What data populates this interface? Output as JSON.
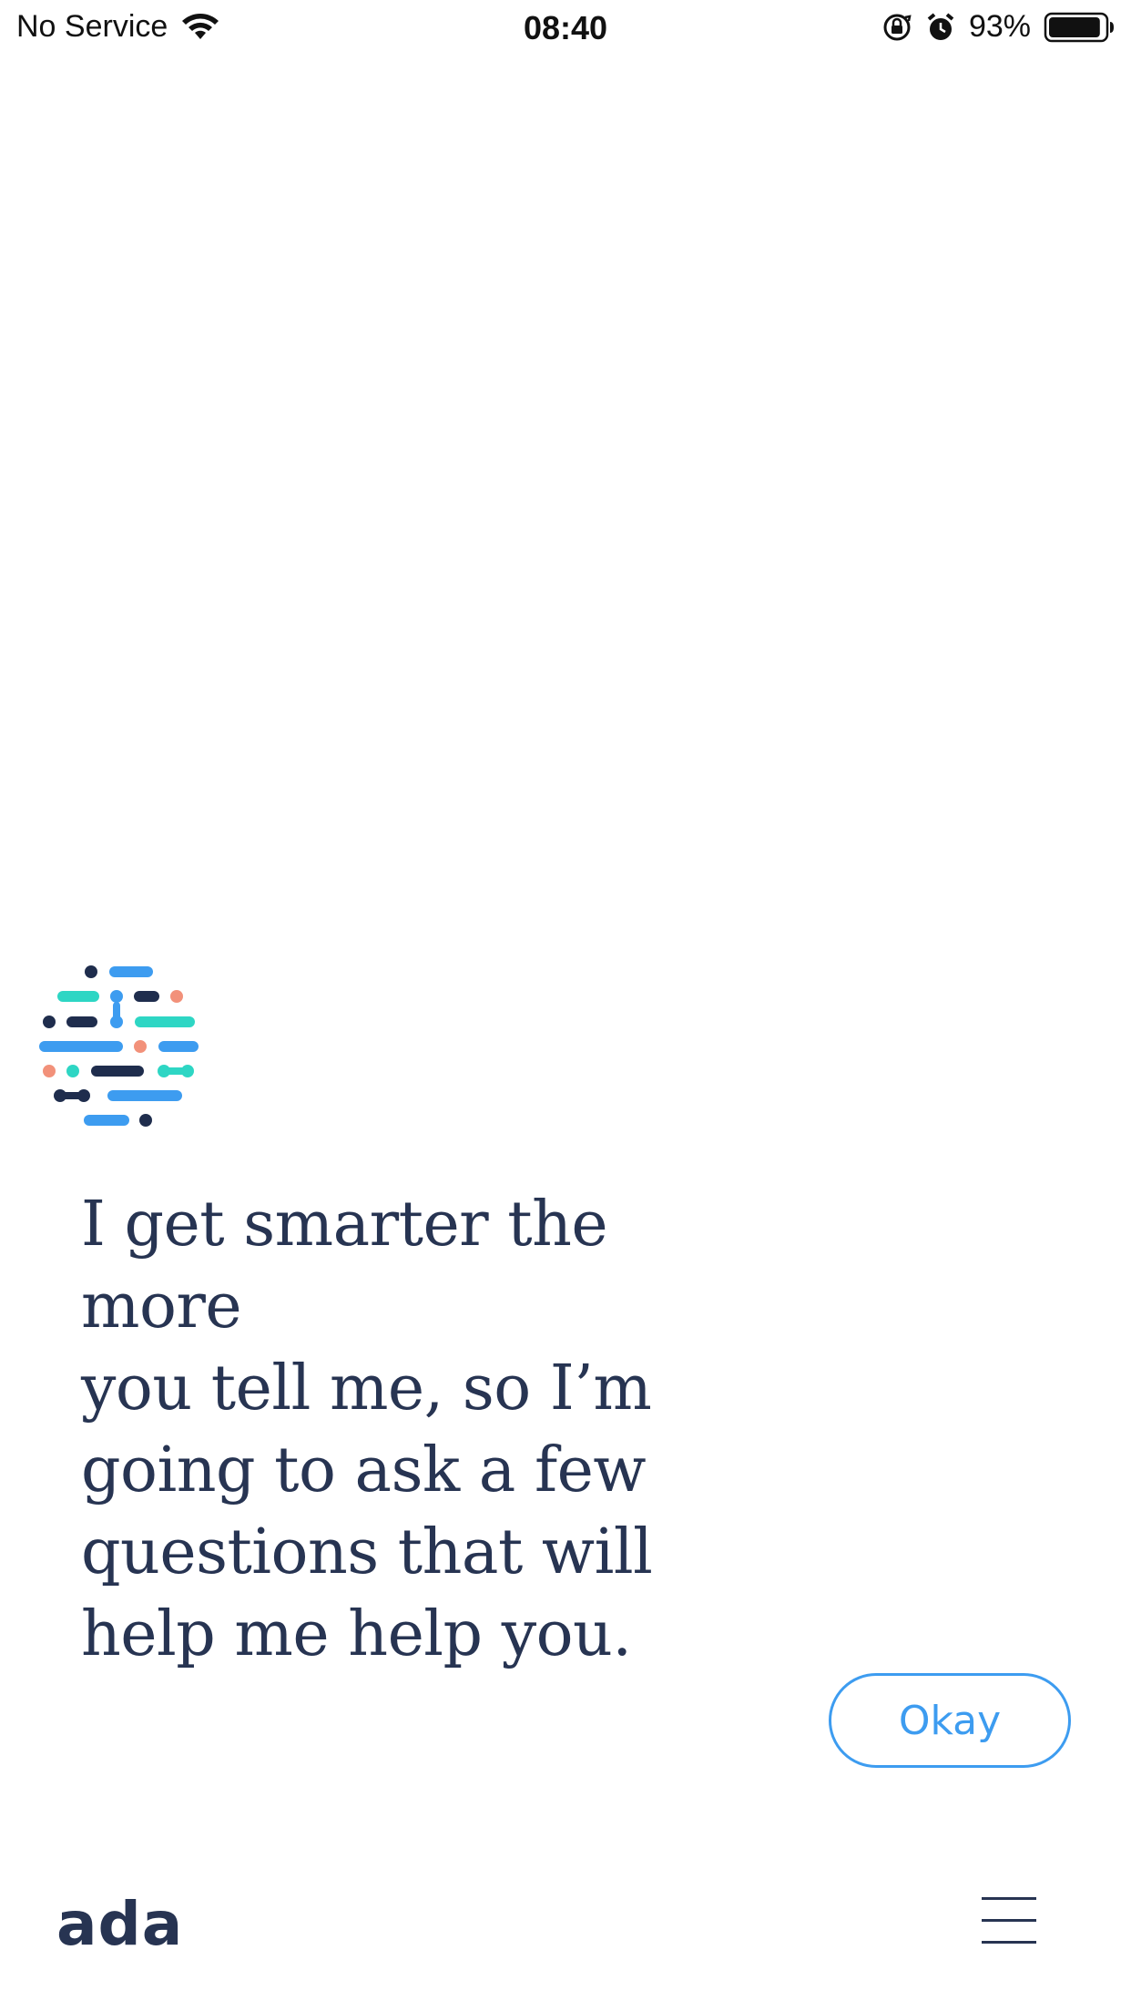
{
  "status_bar": {
    "carrier": "No Service",
    "time": "08:40",
    "battery_percent": "93%",
    "icons": [
      "wifi-icon",
      "orientation-lock-icon",
      "alarm-icon",
      "battery-icon"
    ],
    "battery_level": 0.93
  },
  "message": {
    "lines": [
      "I get smarter the more",
      "you tell me, so I’m",
      "going to ask a few",
      "questions that will",
      "help me help you."
    ]
  },
  "actions": {
    "okay_label": "Okay"
  },
  "footer": {
    "brand": "ada",
    "menu_icon": "hamburger-menu-icon"
  },
  "colors": {
    "text": "#273452",
    "accent": "#3d9cf0",
    "teal": "#2ed6c4",
    "navy": "#1f2d4d",
    "coral": "#f2917a",
    "blue": "#3d9cf0"
  }
}
